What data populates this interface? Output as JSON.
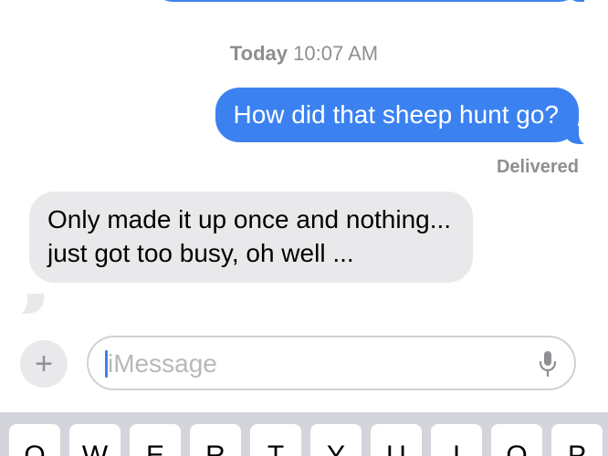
{
  "conversation": {
    "timestamp_day": "Today",
    "timestamp_time": "10:07 AM",
    "sent_message": "How did that sheep hunt go?",
    "delivery_status": "Delivered",
    "received_message": "Only made it up once and nothing... just got too busy, oh well ..."
  },
  "composer": {
    "plus_label": "+",
    "placeholder": "iMessage",
    "mic_icon": "microphone-icon"
  },
  "keyboard": {
    "keys": [
      "Q",
      "W",
      "E",
      "R",
      "T",
      "Y",
      "U",
      "I",
      "O",
      "P"
    ]
  },
  "colors": {
    "sent_bubble": "#3b82f0",
    "received_bubble": "#e9e9eb",
    "meta_text": "#8e8e93",
    "keyboard_bg": "#d3d5db"
  }
}
